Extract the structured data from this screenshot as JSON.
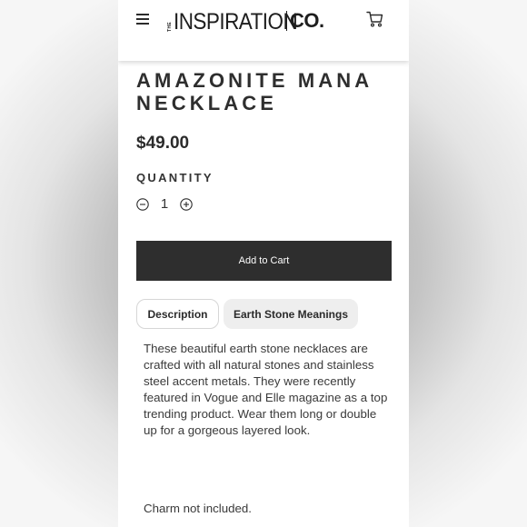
{
  "header": {
    "logo_small": "THE",
    "logo_main": "INSPIRATION",
    "logo_suffix": "CO.",
    "menu_icon": "hamburger-menu-icon",
    "cart_icon": "shopping-cart-icon"
  },
  "product": {
    "title": "AMAZONITE MANA NECKLACE",
    "price": "$49.00"
  },
  "quantity": {
    "label": "QUANTITY",
    "value": "1",
    "decrease_icon": "minus-circle-icon",
    "increase_icon": "plus-circle-icon"
  },
  "add_to_cart_label": "Add to Cart",
  "tabs": [
    {
      "label": "Description",
      "active": true
    },
    {
      "label": "Earth Stone Meanings",
      "active": false
    }
  ],
  "description": {
    "body": "These beautiful earth stone necklaces are crafted with all natural stones and stainless steel accent metals. They were recently featured in Vogue and Elle magazine as a top trending product. Wear them long or double up for a gorgeous layered look.",
    "note": "Charm not included."
  },
  "colors": {
    "button_bg": "#2e2e2e",
    "text": "#2e2e2e",
    "tab_inactive_bg": "#eeeeee"
  }
}
